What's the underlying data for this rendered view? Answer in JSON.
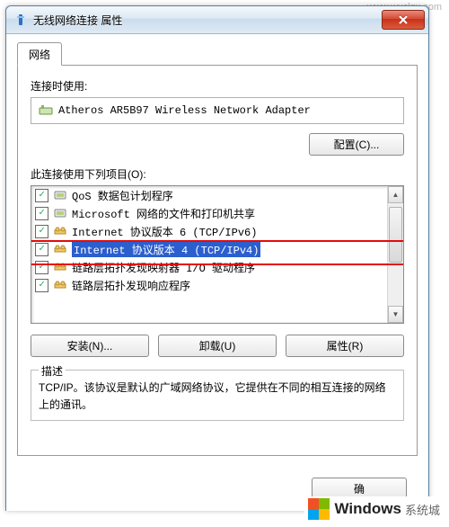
{
  "overlay": {
    "url": "www.wxclqx.com"
  },
  "window": {
    "title": "无线网络连接 属性"
  },
  "tab": {
    "label": "网络"
  },
  "adapter": {
    "label": "连接时使用:",
    "name": "Atheros AR5B97 Wireless Network Adapter",
    "configure_btn": "配置(C)..."
  },
  "items": {
    "label": "此连接使用下列项目(O):",
    "list": [
      {
        "checked": true,
        "icon": "service",
        "text": "QoS 数据包计划程序"
      },
      {
        "checked": true,
        "icon": "service",
        "text": "Microsoft 网络的文件和打印机共享"
      },
      {
        "checked": true,
        "icon": "proto",
        "text": "Internet 协议版本 6 (TCP/IPv6)"
      },
      {
        "checked": true,
        "icon": "proto",
        "text": "Internet 协议版本 4 (TCP/IPv4)",
        "selected": true
      },
      {
        "checked": true,
        "icon": "proto",
        "text": "链路层拓扑发现映射器 I/O 驱动程序"
      },
      {
        "checked": true,
        "icon": "proto",
        "text": "链路层拓扑发现响应程序"
      }
    ]
  },
  "buttons": {
    "install": "安装(N)...",
    "uninstall": "卸载(U)",
    "properties": "属性(R)"
  },
  "description": {
    "legend": "描述",
    "text": "TCP/IP。该协议是默认的广域网络协议，它提供在不同的相互连接的网络上的通讯。"
  },
  "dialog": {
    "ok_fragment": "确"
  },
  "watermark": {
    "brand": "Windows",
    "tagline": "系统城"
  }
}
